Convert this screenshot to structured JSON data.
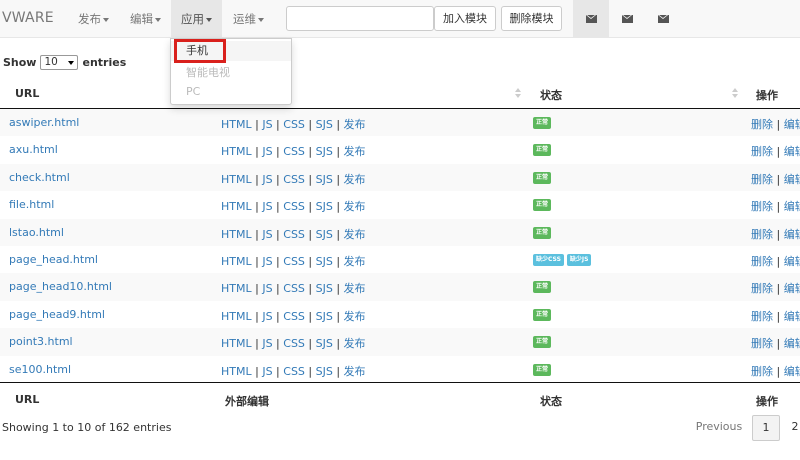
{
  "nav": {
    "brand": "VWARE",
    "menus": [
      "发布",
      "编辑",
      "应用",
      "运维"
    ],
    "search_value": "",
    "add_module": "加入模块",
    "delete_module": "删除模块"
  },
  "dropdown": {
    "items": [
      "手机",
      "智能电视",
      "PC"
    ]
  },
  "length": {
    "show": "Show",
    "value": "10",
    "entries": "entries"
  },
  "table": {
    "headers": {
      "url": "URL",
      "edit": "外部编辑",
      "status": "状态",
      "ops": "操作"
    },
    "link_labels": [
      "HTML",
      "JS",
      "CSS",
      "SJS",
      "发布"
    ],
    "op_labels": [
      "删除",
      "编辑"
    ],
    "rows": [
      {
        "url": "aswiper.html",
        "status": [
          "正常"
        ]
      },
      {
        "url": "axu.html",
        "status": [
          "正常"
        ]
      },
      {
        "url": "check.html",
        "status": [
          "正常"
        ]
      },
      {
        "url": "file.html",
        "status": [
          "正常"
        ]
      },
      {
        "url": "lstao.html",
        "status": [
          "正常"
        ]
      },
      {
        "url": "page_head.html",
        "status": [
          "缺少CSS",
          "缺少JS"
        ]
      },
      {
        "url": "page_head10.html",
        "status": [
          "正常"
        ]
      },
      {
        "url": "page_head9.html",
        "status": [
          "正常"
        ]
      },
      {
        "url": "point3.html",
        "status": [
          "正常"
        ]
      },
      {
        "url": "se100.html",
        "status": [
          "正常"
        ]
      }
    ]
  },
  "footer": {
    "info": "Showing 1 to 10 of 162 entries",
    "previous": "Previous",
    "page1": "1",
    "page2": "2"
  },
  "colors": {
    "link": "#337ab7",
    "ok": "#5cb85c",
    "missing": "#5bc0de",
    "highlight": "#d9201c"
  }
}
